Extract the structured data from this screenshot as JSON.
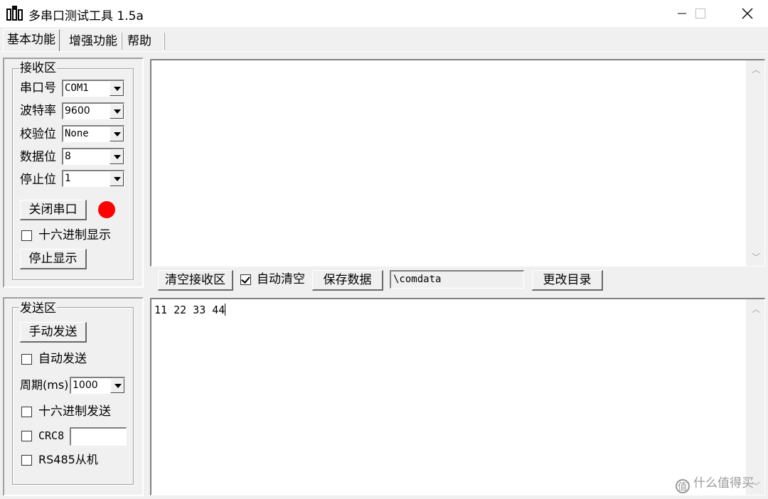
{
  "window": {
    "title": "多串口测试工具 1.5a",
    "controls": {
      "minimize": "minimize-icon",
      "maximize": "maximize-icon",
      "close": "close-icon"
    }
  },
  "tabs": [
    {
      "label": "基本功能",
      "active": true
    },
    {
      "label": "增强功能",
      "active": false
    },
    {
      "label": "帮助",
      "active": false
    }
  ],
  "receive_group": {
    "title": "接收区",
    "port": {
      "label": "串口号",
      "value": "COM1"
    },
    "baud": {
      "label": "波特率",
      "value": "9600"
    },
    "parity": {
      "label": "校验位",
      "value": "None"
    },
    "databits": {
      "label": "数据位",
      "value": "8"
    },
    "stopbits": {
      "label": "停止位",
      "value": "1"
    },
    "close_port_button": "关闭串口",
    "status_led_color": "#ff0000",
    "hex_display": {
      "label": "十六进制显示",
      "checked": false
    },
    "stop_display_button": "停止显示"
  },
  "receive_toolbar": {
    "clear_button": "清空接收区",
    "auto_clear": {
      "label": "自动清空",
      "checked": true
    },
    "save_button": "保存数据",
    "path_value": "\\comdata",
    "change_dir_button": "更改目录"
  },
  "receive_area": {
    "text": ""
  },
  "send_group": {
    "title": "发送区",
    "manual_send_button": "手动发送",
    "auto_send": {
      "label": "自动发送",
      "checked": false
    },
    "period": {
      "label": "周期(ms)",
      "value": "1000"
    },
    "hex_send": {
      "label": "十六进制发送",
      "checked": false
    },
    "crc8": {
      "label": "CRC8",
      "checked": false,
      "value": ""
    },
    "rs485": {
      "label": "RS485从机",
      "checked": false
    }
  },
  "send_area": {
    "text": "11 22 33 44"
  },
  "watermark": {
    "text": "什么值得买",
    "icon": "watermark-logo-icon"
  }
}
